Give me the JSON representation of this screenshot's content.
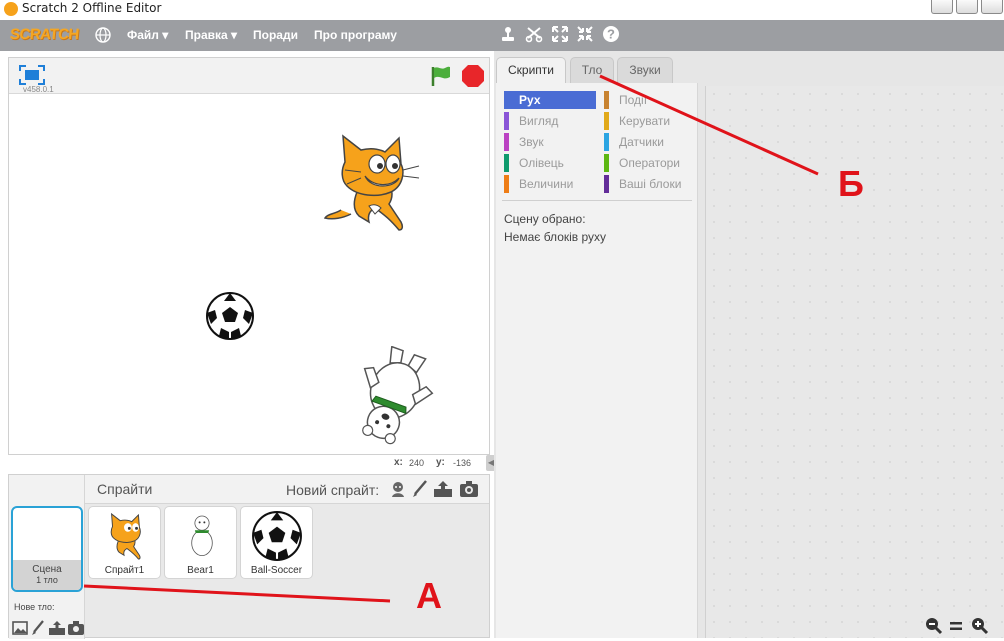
{
  "window": {
    "title": "Scratch 2 Offline Editor"
  },
  "menubar": {
    "logo": "SCRATCH",
    "file": "Файл",
    "edit": "Правка",
    "tips": "Поради",
    "about": "Про програму"
  },
  "stage": {
    "version": "v458.0.1",
    "x_label": "x:",
    "x_value": "240",
    "y_label": "y:",
    "y_value": "-136"
  },
  "tabs": {
    "scripts": "Скрипти",
    "backdrops": "Тло",
    "sounds": "Звуки"
  },
  "palette": {
    "left": [
      {
        "label": "Рух",
        "color": "#4a6cd4"
      },
      {
        "label": "Вигляд",
        "color": "#8a55d7"
      },
      {
        "label": "Звук",
        "color": "#bb42c3"
      },
      {
        "label": "Олівець",
        "color": "#0e9a6c"
      },
      {
        "label": "Величини",
        "color": "#ee7d16"
      }
    ],
    "right": [
      {
        "label": "Події",
        "color": "#c88330"
      },
      {
        "label": "Керувати",
        "color": "#e1a91a"
      },
      {
        "label": "Датчики",
        "color": "#2ca5e2"
      },
      {
        "label": "Оператори",
        "color": "#5cb712"
      },
      {
        "label": "Ваші блоки",
        "color": "#632d99"
      }
    ],
    "status_line1": "Сцену обрано:",
    "status_line2": "Немає блоків руху"
  },
  "sprites": {
    "header": "Спрайти",
    "new_sprite": "Новий спрайт:",
    "items": [
      {
        "name": "Спрайт1"
      },
      {
        "name": "Bear1"
      },
      {
        "name": "Ball-Soccer"
      }
    ]
  },
  "scene": {
    "name": "Сцена",
    "backdrop_count": "1 тло",
    "new_backdrop": "Нове тло:"
  },
  "annotations": {
    "a": "А",
    "b": "Б",
    "color": "#e0131a"
  }
}
